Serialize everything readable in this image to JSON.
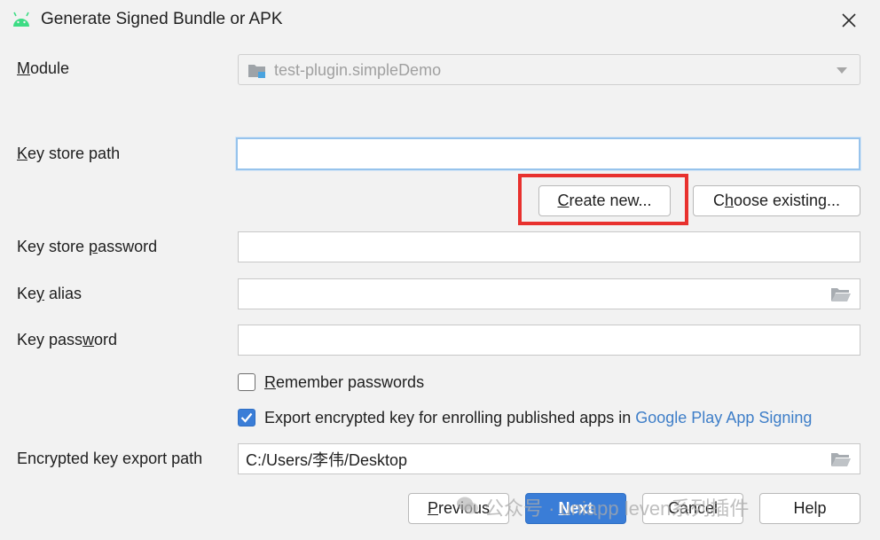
{
  "window": {
    "title": "Generate Signed Bundle or APK",
    "close_icon": "close-icon",
    "app_icon": "android-icon"
  },
  "module": {
    "label_hotkey": "M",
    "label_rest": "odule",
    "value": "test-plugin.simpleDemo"
  },
  "keystore_path": {
    "label_hotkey": "K",
    "label_rest": "ey store path",
    "value": ""
  },
  "buttons": {
    "create_new_hotkey": "C",
    "create_new_rest": "reate new...",
    "choose_existing_pre": "C",
    "choose_existing_hotkey": "h",
    "choose_existing_rest": "oose existing..."
  },
  "keystore_password": {
    "label_pre": "Key store ",
    "label_hotkey": "p",
    "label_rest": "assword",
    "value": ""
  },
  "key_alias": {
    "label_pre": "Ke",
    "label_hotkey": "y",
    "label_rest": " alias",
    "value": ""
  },
  "key_password": {
    "label_pre": "Key pass",
    "label_hotkey": "w",
    "label_rest": "ord",
    "value": ""
  },
  "remember": {
    "hotkey": "R",
    "rest": "emember passwords",
    "checked": false
  },
  "export": {
    "label": "Export encrypted key for enrolling published apps in ",
    "link": "Google Play App Signing",
    "checked": true
  },
  "export_path": {
    "label": "Encrypted key export path",
    "value": "C:/Users/李伟/Desktop"
  },
  "footer": {
    "previous_hotkey": "P",
    "previous_rest": "revious",
    "next_hotkey": "N",
    "next_rest": "ext",
    "cancel": "Cancel",
    "help": "Help"
  },
  "watermark": {
    "text": "公众号 · uniapp leven系列插件"
  },
  "colors": {
    "accent": "#3a7dd7",
    "highlight": "#e8312e",
    "link": "#3e7ec8"
  }
}
